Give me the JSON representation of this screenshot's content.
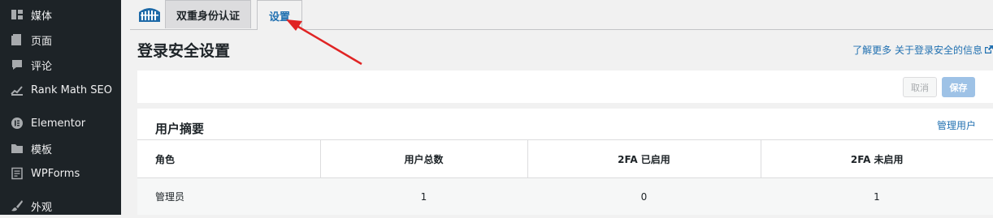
{
  "sidebar": {
    "items": [
      {
        "label": "媒体",
        "icon": "media-icon"
      },
      {
        "label": "页面",
        "icon": "page-icon"
      },
      {
        "label": "评论",
        "icon": "comment-icon"
      },
      {
        "label": "Rank Math SEO",
        "icon": "rank-math-icon"
      },
      {
        "label": "Elementor",
        "icon": "elementor-icon"
      },
      {
        "label": "模板",
        "icon": "folder-icon"
      },
      {
        "label": "WPForms",
        "icon": "wpforms-icon"
      },
      {
        "label": "外观",
        "icon": "brush-icon"
      }
    ]
  },
  "tabs": [
    {
      "label": "双重身份认证"
    },
    {
      "label": "设置"
    }
  ],
  "page": {
    "title": "登录安全设置",
    "learn_more": "了解更多 关于登录安全的信息"
  },
  "actions": {
    "cancel": "取消",
    "save": "保存"
  },
  "summary": {
    "title": "用户摘要",
    "manage_users": "管理用户",
    "columns": [
      "角色",
      "用户总数",
      "2FA 已启用",
      "2FA 未启用"
    ],
    "rows": [
      {
        "role": "管理员",
        "total": "1",
        "enabled": "0",
        "disabled": "1"
      }
    ]
  },
  "colors": {
    "sidebar_bg": "#1d2327",
    "link": "#2271b1",
    "annotation": "#e02424"
  }
}
